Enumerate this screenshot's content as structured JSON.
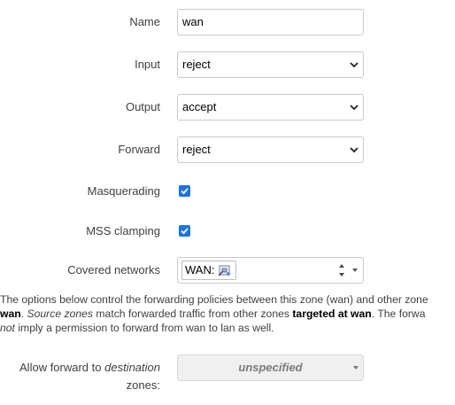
{
  "form": {
    "name": {
      "label": "Name",
      "value": "wan"
    },
    "input": {
      "label": "Input",
      "value": "reject"
    },
    "output": {
      "label": "Output",
      "value": "accept"
    },
    "forward": {
      "label": "Forward",
      "value": "reject"
    },
    "masquerading": {
      "label": "Masquerading",
      "checked": true
    },
    "mss_clamping": {
      "label": "MSS clamping",
      "checked": true
    },
    "covered_networks": {
      "label": "Covered networks",
      "tag": "WAN:",
      "tag_icon": "ethernet-port-icon"
    }
  },
  "description": {
    "line1": "The options below control the forwarding policies between this zone (wan) and other zone",
    "line2_bold1": "wan",
    "line2_rest1": ". ",
    "line2_italic": "Source zones",
    "line2_rest2": " match forwarded traffic from other zones ",
    "line2_bold2": "targeted at wan",
    "line2_rest3": ". The forwa",
    "line3_italic": "not",
    "line3_rest": " imply a permission to forward from wan to lan as well."
  },
  "forward_dest": {
    "label_prefix": "Allow forward to ",
    "label_italic": "destination",
    "label_line2": "zones",
    "label_colon": ":",
    "value": "unspecified"
  },
  "colors": {
    "checkbox": "#1a73e8",
    "border": "#c9c9c9",
    "disabled_bg": "#f0f0f0"
  }
}
